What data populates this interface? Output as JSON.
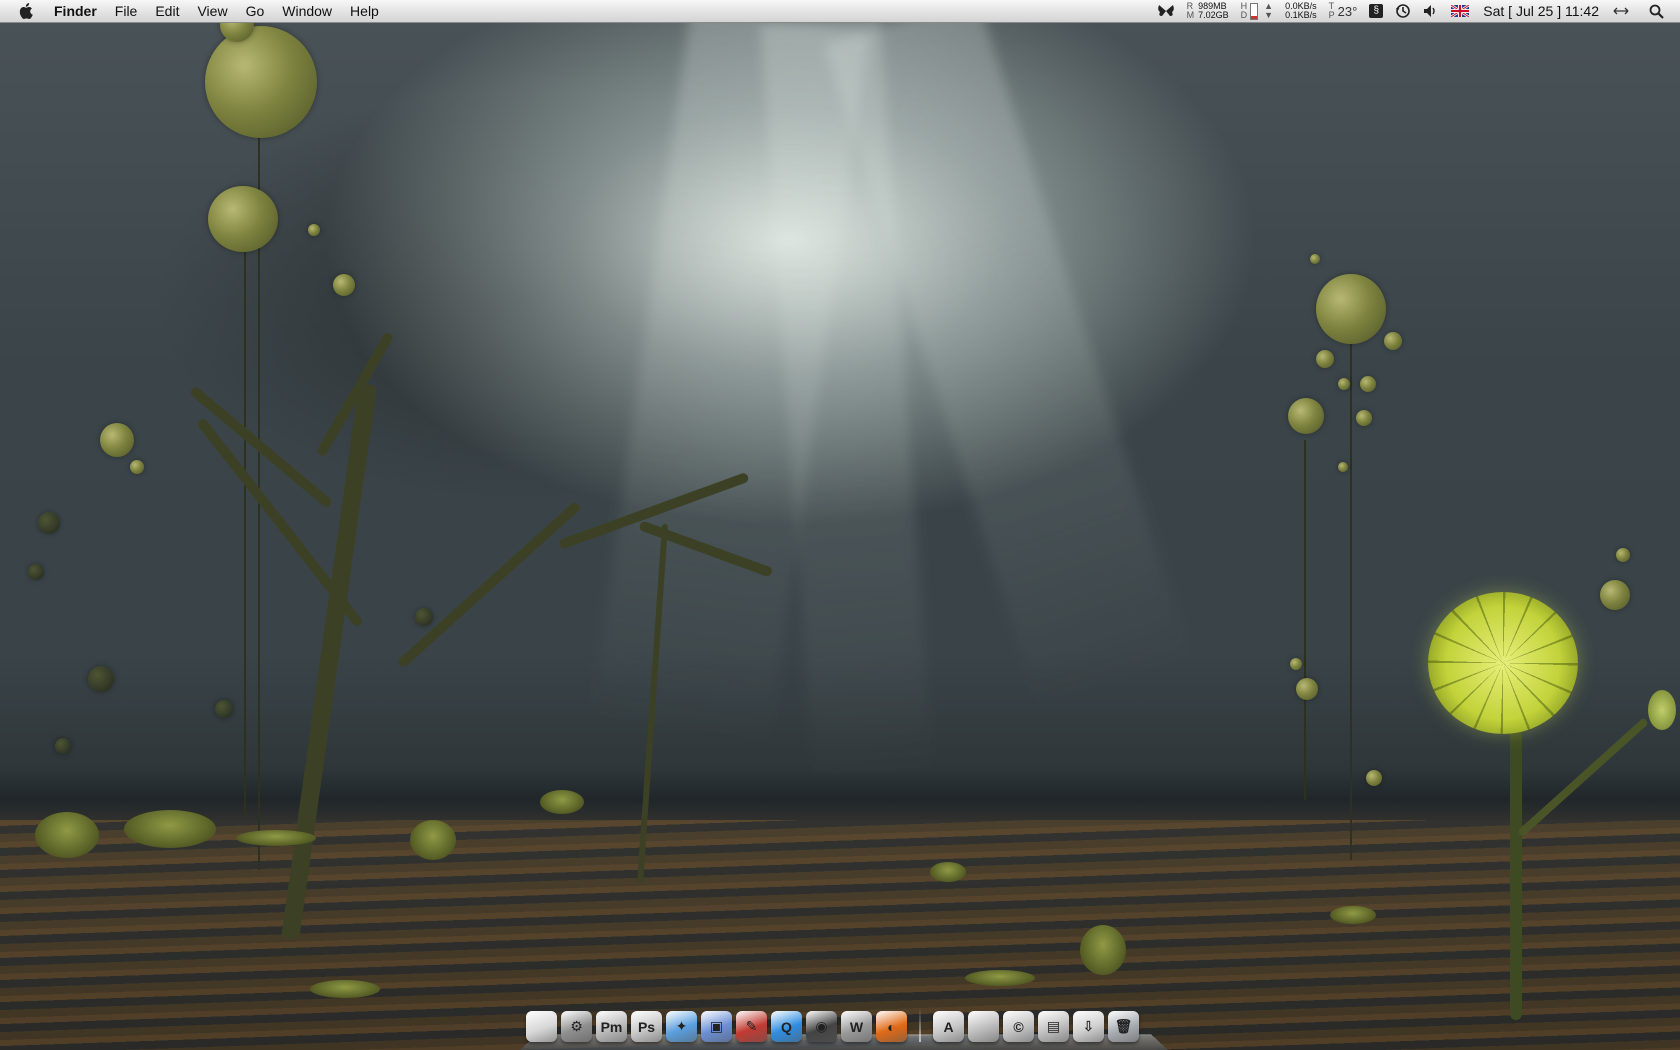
{
  "menubar": {
    "app_name": "Finder",
    "menus": [
      {
        "label": "File"
      },
      {
        "label": "Edit"
      },
      {
        "label": "View"
      },
      {
        "label": "Go"
      },
      {
        "label": "Window"
      },
      {
        "label": "Help"
      }
    ],
    "status": {
      "memory_used": "989MB",
      "memory_free": "7.02GB",
      "net_down": "0.0KB/s",
      "net_up": "0.1KB/s",
      "temperature": "23°",
      "clock": "Sat  [ Jul 25 ] 11:42"
    }
  },
  "dock": {
    "items": [
      {
        "name": "finder-dock-icon",
        "glyph": "",
        "color": "#d8d8d8"
      },
      {
        "name": "system-preferences-dock-icon",
        "glyph": "⚙",
        "color": "#8f8f8f"
      },
      {
        "name": "pixelmator-dock-icon",
        "glyph": "Pm",
        "color": "#bcbcbc"
      },
      {
        "name": "photoshop-dock-icon",
        "glyph": "Ps",
        "color": "#c9c9c9"
      },
      {
        "name": "safari-dock-icon",
        "glyph": "✦",
        "color": "#5aa0e0"
      },
      {
        "name": "preview-dock-icon",
        "glyph": "▣",
        "color": "#6b8fd6"
      },
      {
        "name": "script-editor-dock-icon",
        "glyph": "✎",
        "color": "#c23b32"
      },
      {
        "name": "quicktime-dock-icon",
        "glyph": "Q",
        "color": "#2f8de0"
      },
      {
        "name": "dvd-player-dock-icon",
        "glyph": "◉",
        "color": "#444444"
      },
      {
        "name": "iwork-dock-icon",
        "glyph": "W",
        "color": "#9a9a9a"
      },
      {
        "name": "firefox-dock-icon",
        "glyph": "◐",
        "color": "#e06a17"
      }
    ],
    "folders": [
      {
        "name": "applications-folder-dock-icon",
        "glyph": "A",
        "color": "#c8c8c8"
      },
      {
        "name": "mac-folder-dock-icon",
        "glyph": "",
        "color": "#bdbdbd"
      },
      {
        "name": "copyright-folder-dock-icon",
        "glyph": "©",
        "color": "#c4c4c4"
      },
      {
        "name": "documents-folder-dock-icon",
        "glyph": "▤",
        "color": "#c0c0c0"
      },
      {
        "name": "downloads-folder-dock-icon",
        "glyph": "⇩",
        "color": "#d0d0d0"
      },
      {
        "name": "trash-dock-icon",
        "glyph": "🗑",
        "color": "#a8adb2"
      }
    ]
  }
}
